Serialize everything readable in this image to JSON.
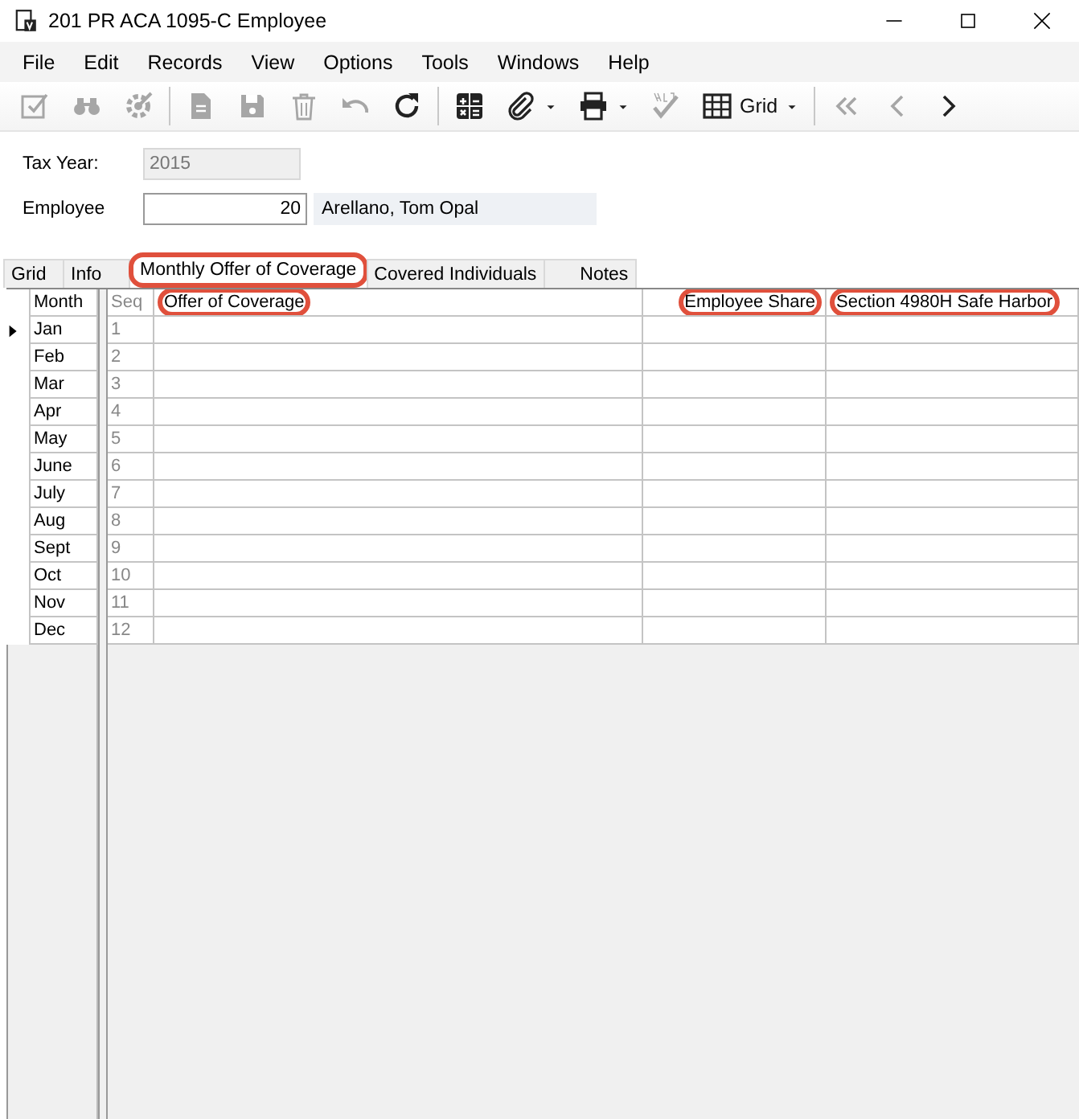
{
  "window": {
    "title": "201 PR ACA 1095-C Employee"
  },
  "menu": [
    "File",
    "Edit",
    "Records",
    "View",
    "Options",
    "Tools",
    "Windows",
    "Help"
  ],
  "toolbar": [
    {
      "kind": "edit",
      "disabled": true
    },
    {
      "kind": "find",
      "disabled": true
    },
    {
      "kind": "process",
      "disabled": true
    },
    {
      "kind": "separator"
    },
    {
      "kind": "document",
      "disabled": true
    },
    {
      "kind": "save",
      "disabled": true
    },
    {
      "kind": "delete",
      "disabled": true
    },
    {
      "kind": "undo",
      "disabled": true
    },
    {
      "kind": "refresh",
      "disabled": false
    },
    {
      "kind": "separator"
    },
    {
      "kind": "calculator",
      "disabled": false
    },
    {
      "kind": "attach",
      "disabled": false,
      "dropdown": true
    },
    {
      "kind": "print",
      "disabled": false,
      "dropdown": true
    },
    {
      "kind": "spelling",
      "disabled": true
    },
    {
      "kind": "grid",
      "disabled": false,
      "dropdown": true,
      "label": "Grid"
    },
    {
      "kind": "separator"
    },
    {
      "kind": "first",
      "disabled": true
    },
    {
      "kind": "previous",
      "disabled": true
    },
    {
      "kind": "next",
      "disabled": false
    }
  ],
  "form": {
    "tax_year": {
      "label": "Tax Year:",
      "value": "2015",
      "disabled": true
    },
    "employee": {
      "label": "Employee",
      "value": "20",
      "name": "Arellano, Tom Opal"
    }
  },
  "tabs": [
    {
      "label": "Grid",
      "selected": false,
      "highlighted": false
    },
    {
      "label": "Info",
      "selected": false,
      "highlighted": false
    },
    {
      "label": "Monthly Offer of Coverage",
      "selected": true,
      "highlighted": true
    },
    {
      "label": "Covered Individuals",
      "selected": false,
      "highlighted": false
    },
    {
      "label": "Notes",
      "selected": false,
      "highlighted": false
    }
  ],
  "grid": {
    "columns": [
      {
        "label": "Month",
        "highlighted": false
      },
      {
        "label": "Seq",
        "highlighted": false
      },
      {
        "label": "Offer of Coverage",
        "highlighted": true
      },
      {
        "label": "Employee Share",
        "highlighted": true
      },
      {
        "label": "Section 4980H Safe Harbor",
        "highlighted": true
      }
    ],
    "rows": [
      {
        "month": "Jan",
        "seq": "1",
        "current": true
      },
      {
        "month": "Feb",
        "seq": "2",
        "current": false
      },
      {
        "month": "Mar",
        "seq": "3",
        "current": false
      },
      {
        "month": "Apr",
        "seq": "4",
        "current": false
      },
      {
        "month": "May",
        "seq": "5",
        "current": false
      },
      {
        "month": "June",
        "seq": "6",
        "current": false
      },
      {
        "month": "July",
        "seq": "7",
        "current": false
      },
      {
        "month": "Aug",
        "seq": "8",
        "current": false
      },
      {
        "month": "Sept",
        "seq": "9",
        "current": false
      },
      {
        "month": "Oct",
        "seq": "10",
        "current": false
      },
      {
        "month": "Nov",
        "seq": "11",
        "current": false
      },
      {
        "month": "Dec",
        "seq": "12",
        "current": false
      }
    ]
  }
}
